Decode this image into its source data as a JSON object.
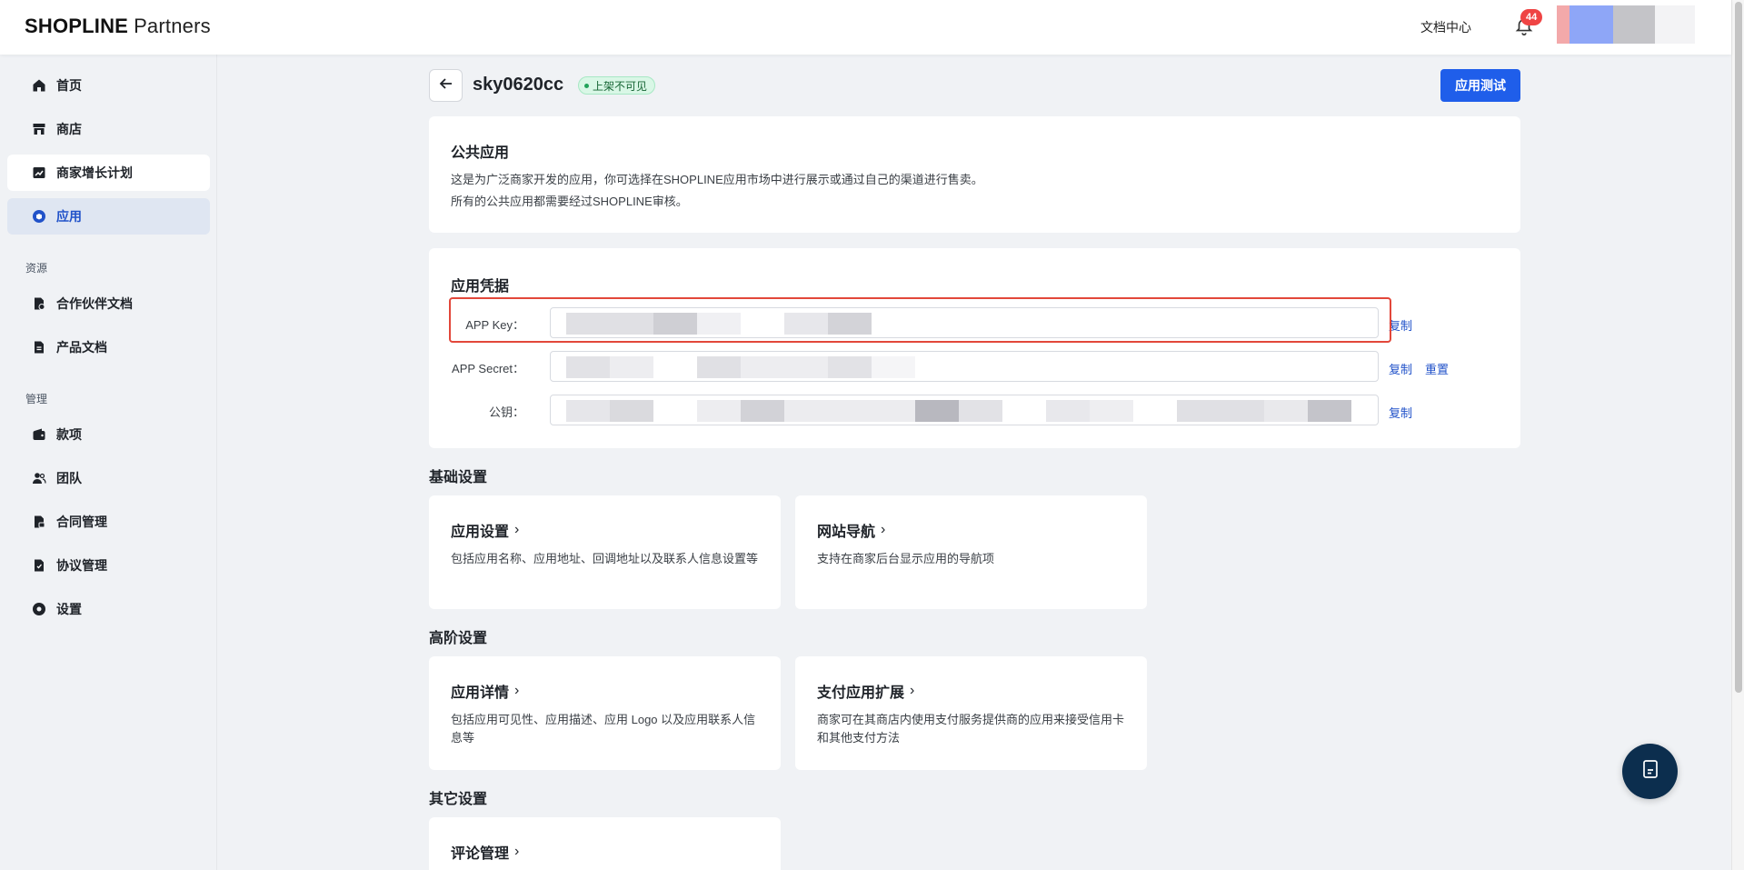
{
  "header": {
    "logo_brand": "SHOPLINE",
    "logo_suffix": "Partners",
    "doc_center": "文档中心",
    "notification_count": "44",
    "avatar_colors": [
      "#f3a9aa",
      "#8ea6f7",
      "#c4c4c8",
      "#f3f3f5"
    ]
  },
  "sidebar": {
    "items": [
      {
        "label": "首页",
        "icon": "home-icon"
      },
      {
        "label": "商店",
        "icon": "store-icon"
      },
      {
        "label": "商家增长计划",
        "icon": "chart-icon"
      },
      {
        "label": "应用",
        "icon": "app-cube-icon"
      }
    ],
    "resources_label": "资源",
    "resource_items": [
      {
        "label": "合作伙伴文档",
        "icon": "partner-doc-icon"
      },
      {
        "label": "产品文档",
        "icon": "product-doc-icon"
      }
    ],
    "manage_label": "管理",
    "manage_items": [
      {
        "label": "款项",
        "icon": "wallet-icon"
      },
      {
        "label": "团队",
        "icon": "team-icon"
      },
      {
        "label": "合同管理",
        "icon": "contract-icon"
      },
      {
        "label": "协议管理",
        "icon": "agreement-icon"
      },
      {
        "label": "设置",
        "icon": "settings-icon"
      }
    ]
  },
  "page": {
    "app_name": "sky0620cc",
    "status": "上架不可见",
    "test_button": "应用测试"
  },
  "public_app": {
    "title": "公共应用",
    "line1": "这是为广泛商家开发的应用，你可选择在SHOPLINE应用市场中进行展示或通过自己的渠道进行售卖。",
    "line2": "所有的公共应用都需要经过SHOPLINE审核。"
  },
  "credentials": {
    "title": "应用凭据",
    "app_key_label": "APP Key：",
    "app_secret_label": "APP Secret：",
    "public_key_label": "公钥：",
    "copy": "复制",
    "reset": "重置"
  },
  "basic_settings": {
    "title": "基础设置",
    "cards": [
      {
        "title": "应用设置",
        "desc": "包括应用名称、应用地址、回调地址以及联系人信息设置等"
      },
      {
        "title": "网站导航",
        "desc": "支持在商家后台显示应用的导航项"
      }
    ]
  },
  "advanced_settings": {
    "title": "高阶设置",
    "cards": [
      {
        "title": "应用详情",
        "desc": "包括应用可见性、应用描述、应用 Logo 以及应用联系人信息等"
      },
      {
        "title": "支付应用扩展",
        "desc": "商家可在其商店内使用支付服务提供商的应用来接受信用卡和其他支付方法"
      }
    ]
  },
  "other_settings": {
    "title": "其它设置",
    "cards": [
      {
        "title": "评论管理"
      }
    ]
  },
  "colors": {
    "primary": "#1f5eea",
    "link": "#2152c9",
    "highlight_frame": "#e2473a",
    "status_bg": "#d9f7e6"
  }
}
